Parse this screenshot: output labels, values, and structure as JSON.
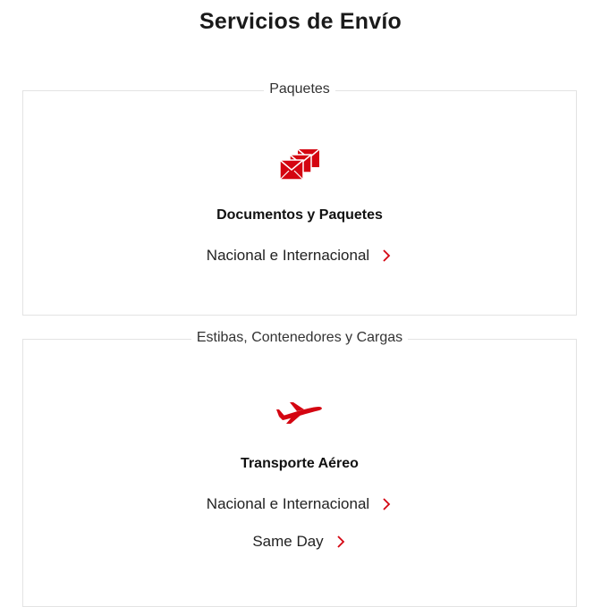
{
  "page": {
    "title": "Servicios de Envío"
  },
  "colors": {
    "accent": "#d40511",
    "border": "#e3e3e3",
    "text": "#1a1a1a"
  },
  "sections": [
    {
      "legend": "Paquetes",
      "icon": "envelopes-icon",
      "service_title": "Documentos y Paquetes",
      "links": [
        {
          "label": "Nacional e Internacional"
        }
      ]
    },
    {
      "legend": "Estibas, Contenedores y Cargas",
      "icon": "airplane-icon",
      "service_title": "Transporte Aéreo",
      "links": [
        {
          "label": "Nacional e Internacional"
        },
        {
          "label": "Same Day"
        }
      ]
    }
  ]
}
